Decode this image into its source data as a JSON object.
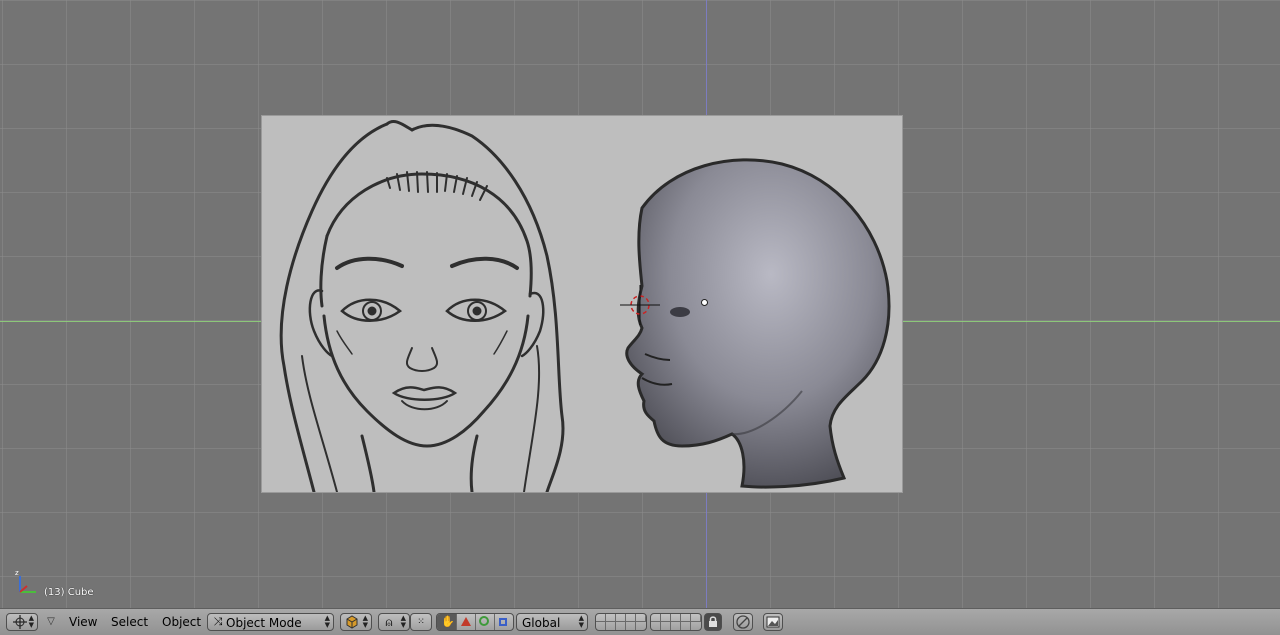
{
  "viewport": {
    "object_info": "(13) Cube"
  },
  "header": {
    "menus": {
      "view": "View",
      "select": "Select",
      "object": "Object"
    },
    "mode_selector": {
      "value": "Object Mode"
    },
    "orientation_selector": {
      "value": "Global"
    }
  },
  "icons": {
    "editor_type": "3d-view-icon",
    "menu_collapse": "triangle-down-icon",
    "viewport_shading": "solid-shading-icon",
    "pivot": "pivot-point-icon",
    "snap_options": "snap-icon",
    "manipulator": "hand-manipulator-icon",
    "translate": "translate-icon",
    "rotate": "rotate-icon",
    "scale": "scale-icon",
    "layer_lock": "lock-icon",
    "proportional": "proportional-edit-icon",
    "render": "render-icon"
  },
  "colors": {
    "viewport_bg": "#747474",
    "x_axis": "#8fd07a",
    "z_axis": "#7b7bd0",
    "header_bg": "#a0a0a0"
  }
}
